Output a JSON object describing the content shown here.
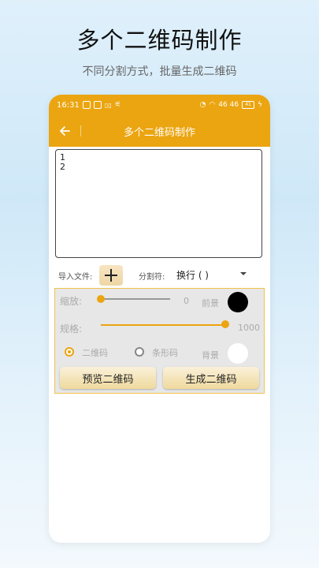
{
  "hero": {
    "title": "多个二维码制作",
    "subtitle": "不同分割方式，批量生成二维码"
  },
  "status_bar": {
    "time": "16:31",
    "left_icons": [
      "N",
      "W",
      "IOI",
      "wifi-bars"
    ],
    "right_text": "46 46",
    "battery": "41"
  },
  "app_bar": {
    "title": "多个二维码制作",
    "back_icon": "arrow-left-icon"
  },
  "editor": {
    "content": "1\n2"
  },
  "import": {
    "label": "导入文件:",
    "plus_icon": "plus-icon",
    "separator_label": "分割符:",
    "separator_value": "换行 ( )"
  },
  "settings": {
    "zoom_label": "缩放:",
    "zoom_value": "0",
    "zoom_fraction": 0,
    "size_label": "规格:",
    "size_value": "1000",
    "size_fraction": 1,
    "foreground_label": "前景",
    "foreground_color": "#000000",
    "background_label": "背景",
    "background_color": "#ffffff",
    "type_qrcode": "二维码",
    "type_barcode": "条形码",
    "selected_type": "qrcode"
  },
  "buttons": {
    "preview": "预览二维码",
    "generate": "生成二维码"
  },
  "colors": {
    "accent": "#eba510"
  }
}
